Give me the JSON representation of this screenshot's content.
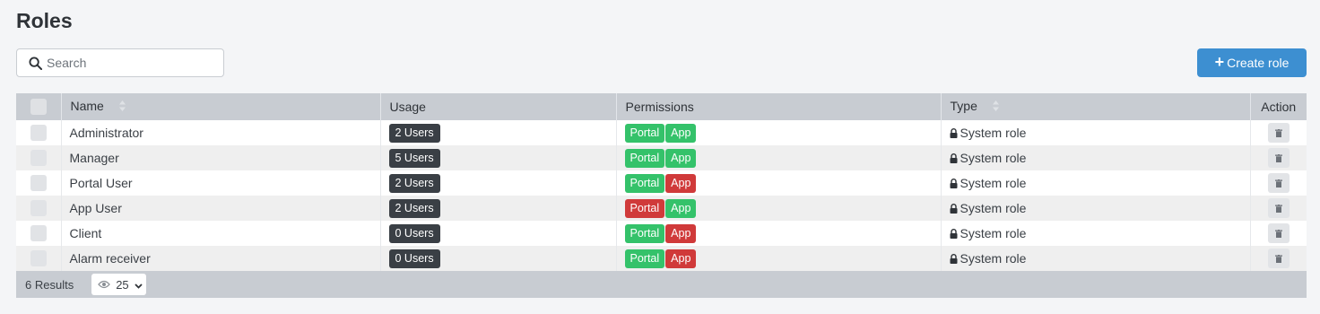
{
  "page": {
    "title": "Roles"
  },
  "search": {
    "placeholder": "Search"
  },
  "toolbar": {
    "create_label": "Create role"
  },
  "table": {
    "columns": {
      "name": "Name",
      "usage": "Usage",
      "permissions": "Permissions",
      "type": "Type",
      "action": "Action"
    },
    "rows": [
      {
        "name": "Administrator",
        "usage": "2 Users",
        "perm_portal": "Portal",
        "perm_portal_granted": true,
        "perm_app": "App",
        "perm_app_granted": true,
        "type": "System role"
      },
      {
        "name": "Manager",
        "usage": "5 Users",
        "perm_portal": "Portal",
        "perm_portal_granted": true,
        "perm_app": "App",
        "perm_app_granted": true,
        "type": "System role"
      },
      {
        "name": "Portal User",
        "usage": "2 Users",
        "perm_portal": "Portal",
        "perm_portal_granted": true,
        "perm_app": "App",
        "perm_app_granted": false,
        "type": "System role"
      },
      {
        "name": "App User",
        "usage": "2 Users",
        "perm_portal": "Portal",
        "perm_portal_granted": false,
        "perm_app": "App",
        "perm_app_granted": true,
        "type": "System role"
      },
      {
        "name": "Client",
        "usage": "0 Users",
        "perm_portal": "Portal",
        "perm_portal_granted": true,
        "perm_app": "App",
        "perm_app_granted": false,
        "type": "System role"
      },
      {
        "name": "Alarm receiver",
        "usage": "0 Users",
        "perm_portal": "Portal",
        "perm_portal_granted": true,
        "perm_app": "App",
        "perm_app_granted": false,
        "type": "System role"
      }
    ]
  },
  "footer": {
    "results": "6 Results",
    "page_size": "25"
  },
  "colors": {
    "accent": "#3d8fd1",
    "granted": "#34c26a",
    "denied": "#d03a3a",
    "badge_dark": "#3a3f45"
  },
  "icons": {
    "search": "search-icon",
    "plus": "plus-icon",
    "sort": "sort-icon",
    "lock": "lock-icon",
    "trash": "trash-icon",
    "eye": "eye-icon",
    "chevron": "chevron-down-icon"
  }
}
